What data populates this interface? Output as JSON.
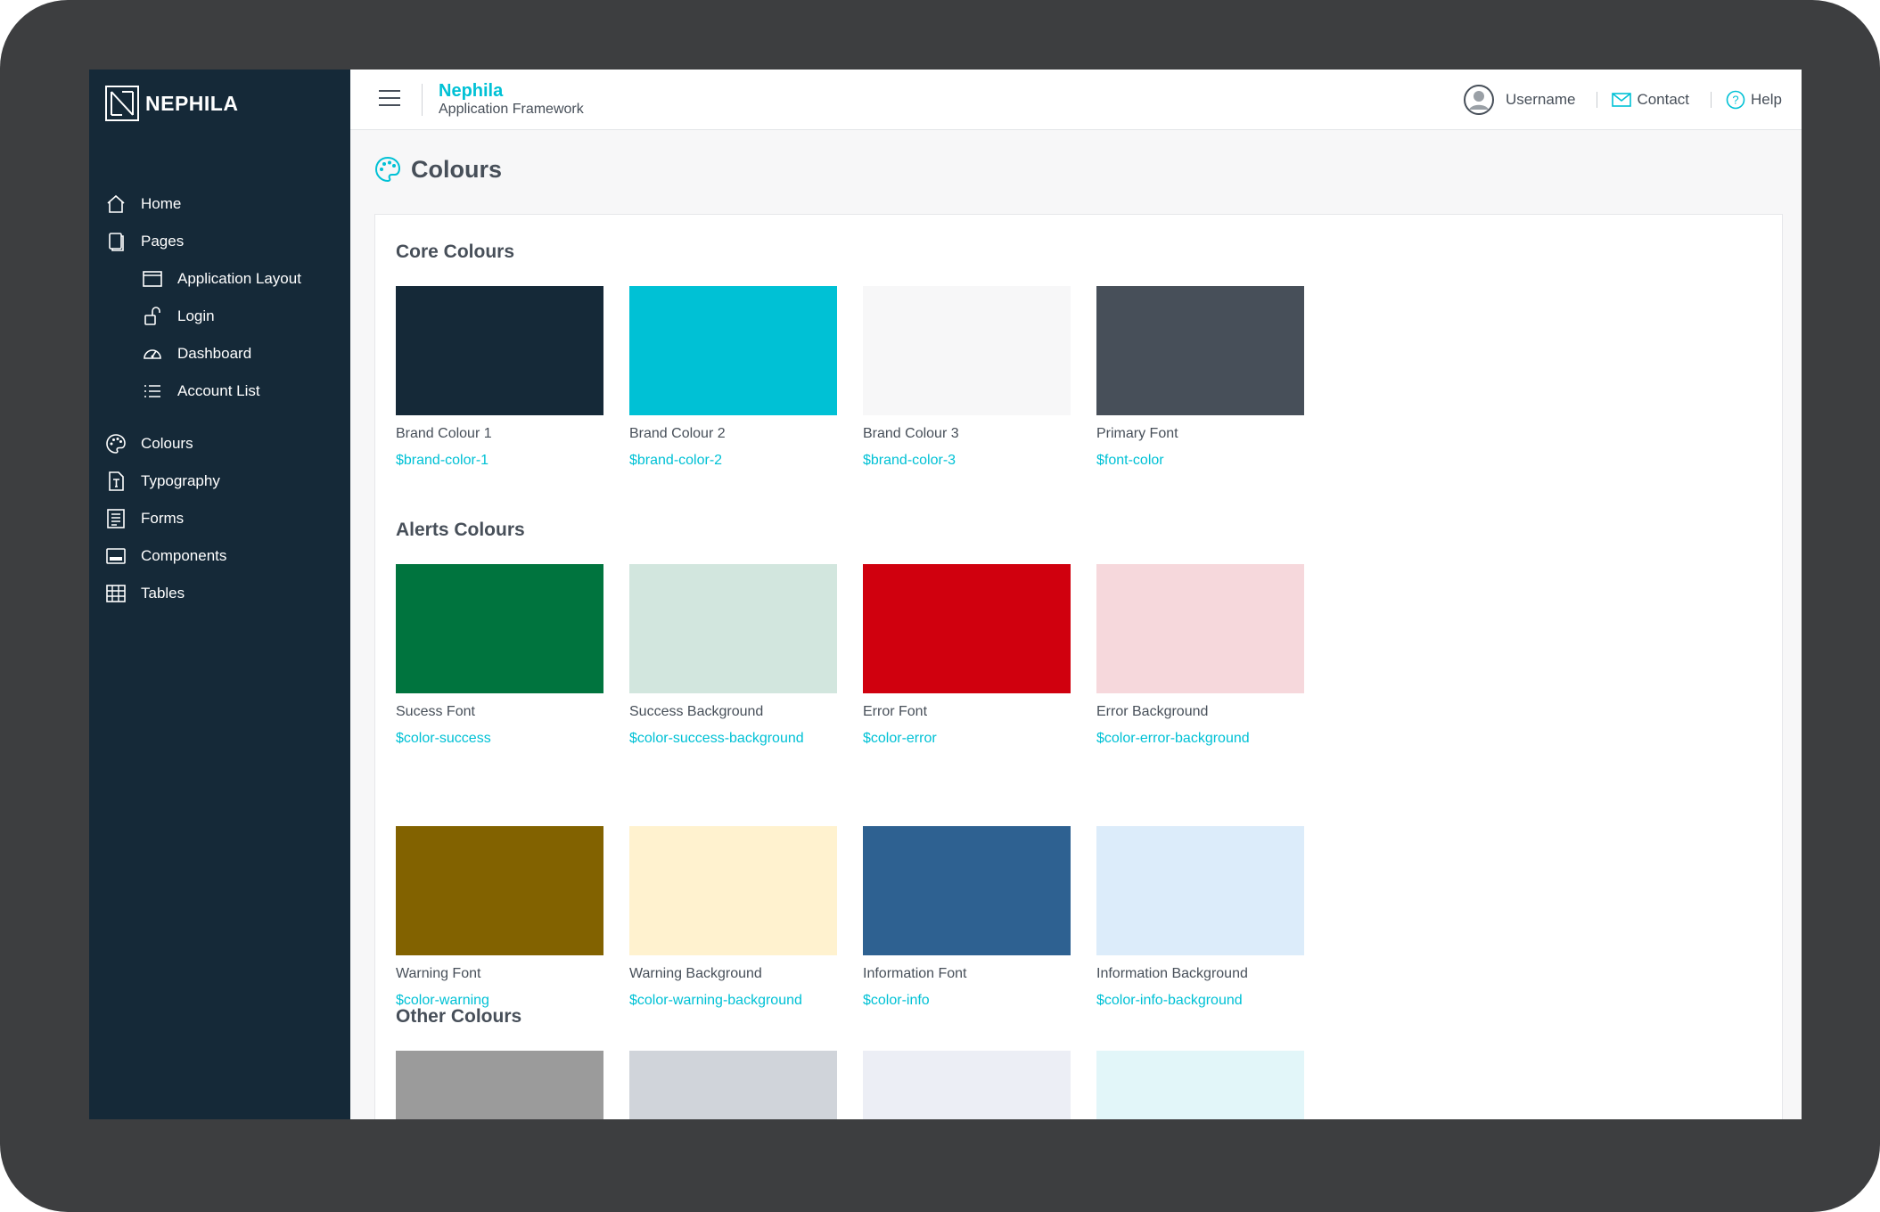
{
  "sidebar": {
    "logo_text": "NEPHILA",
    "nav": [
      {
        "label": "Home",
        "icon": "home-icon",
        "sub": false
      },
      {
        "label": "Pages",
        "icon": "pages-icon",
        "sub": false
      },
      {
        "label": "Application Layout",
        "icon": "layout-icon",
        "sub": true
      },
      {
        "label": "Login",
        "icon": "unlock-icon",
        "sub": true
      },
      {
        "label": "Dashboard",
        "icon": "gauge-icon",
        "sub": true
      },
      {
        "label": "Account List",
        "icon": "list-icon",
        "sub": true
      },
      {
        "label": "Colours",
        "icon": "palette-icon",
        "sub": false,
        "gap_before": true
      },
      {
        "label": "Typography",
        "icon": "typography-icon",
        "sub": false
      },
      {
        "label": "Forms",
        "icon": "form-icon",
        "sub": false
      },
      {
        "label": "Components",
        "icon": "components-icon",
        "sub": false
      },
      {
        "label": "Tables",
        "icon": "table-icon",
        "sub": false
      }
    ]
  },
  "header": {
    "brand_title": "Nephila",
    "brand_subtitle": "Application Framework",
    "username": "Username",
    "contact": "Contact",
    "help": "Help"
  },
  "page": {
    "title": "Colours"
  },
  "sections": {
    "core": {
      "title": "Core Colours",
      "swatches": [
        {
          "name": "Brand Colour 1",
          "var": "$brand-color-1",
          "color": "#152938"
        },
        {
          "name": "Brand Colour 2",
          "var": "$brand-color-2",
          "color": "#00c1d5"
        },
        {
          "name": "Brand Colour 3",
          "var": "$brand-color-3",
          "color": "#f7f7f8"
        },
        {
          "name": "Primary Font",
          "var": "$font-color",
          "color": "#474f59"
        }
      ]
    },
    "alerts": {
      "title": "Alerts Colours",
      "swatches": [
        {
          "name": "Sucess Font",
          "var": "$color-success",
          "color": "#00743e"
        },
        {
          "name": "Success Background",
          "var": "$color-success-background",
          "color": "#d2e6de"
        },
        {
          "name": "Error Font",
          "var": "$color-error",
          "color": "#d0000e"
        },
        {
          "name": "Error Background",
          "var": "$color-error-background",
          "color": "#f6d8dc"
        },
        {
          "name": "Warning Font",
          "var": "$color-warning",
          "color": "#826200"
        },
        {
          "name": "Warning Background",
          "var": "$color-warning-background",
          "color": "#fff2cf"
        },
        {
          "name": "Information Font",
          "var": "$color-info",
          "color": "#2e6191"
        },
        {
          "name": "Information Background",
          "var": "$color-info-background",
          "color": "#dcecfa"
        }
      ]
    },
    "other": {
      "title": "Other Colours",
      "swatches": [
        {
          "color": "#9b9b9b"
        },
        {
          "color": "#d0d4da"
        },
        {
          "color": "#eceef5"
        },
        {
          "color": "#e2f6f9"
        }
      ]
    }
  },
  "colors": {
    "accent": "#00c1d5",
    "sidebar_bg": "#152938",
    "font": "#474f59",
    "page_bg": "#f7f7f8"
  }
}
